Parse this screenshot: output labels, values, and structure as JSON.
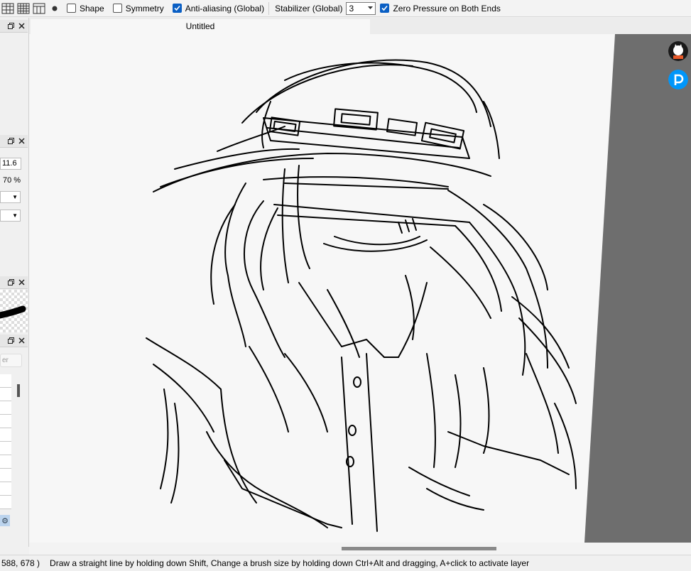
{
  "toolbar": {
    "shape_label": "Shape",
    "symmetry_label": "Symmetry",
    "antialiasing_label": "Anti-aliasing (Global)",
    "stabilizer_label": "Stabilizer (Global)",
    "stabilizer_value": "3",
    "zero_pressure_label": "Zero Pressure on Both Ends",
    "shape_checked": false,
    "symmetry_checked": false,
    "antialiasing_checked": true,
    "zero_pressure_checked": true
  },
  "left_panel": {
    "size_value": "11.6",
    "opacity_value": "70 %",
    "search_placeholder": "er"
  },
  "document": {
    "tab_title": "Untitled"
  },
  "status": {
    "coords": "588, 678 )",
    "hint": "Draw a straight line by holding down Shift, Change a brush size by holding down Ctrl+Alt and dragging, A+click to activate layer"
  },
  "colors": {
    "accent": "#0a5fc4",
    "canvas_bg": "#f7f7f7",
    "workspace": "#6e6e6e",
    "pixiv": "#0096fa"
  },
  "icons": [
    "grid-3x3-icon",
    "grid-4x4-icon",
    "perspective-grid-icon",
    "dot-icon",
    "float-window-icon",
    "close-icon",
    "gear-icon",
    "avatar-icon",
    "pixiv-icon"
  ]
}
